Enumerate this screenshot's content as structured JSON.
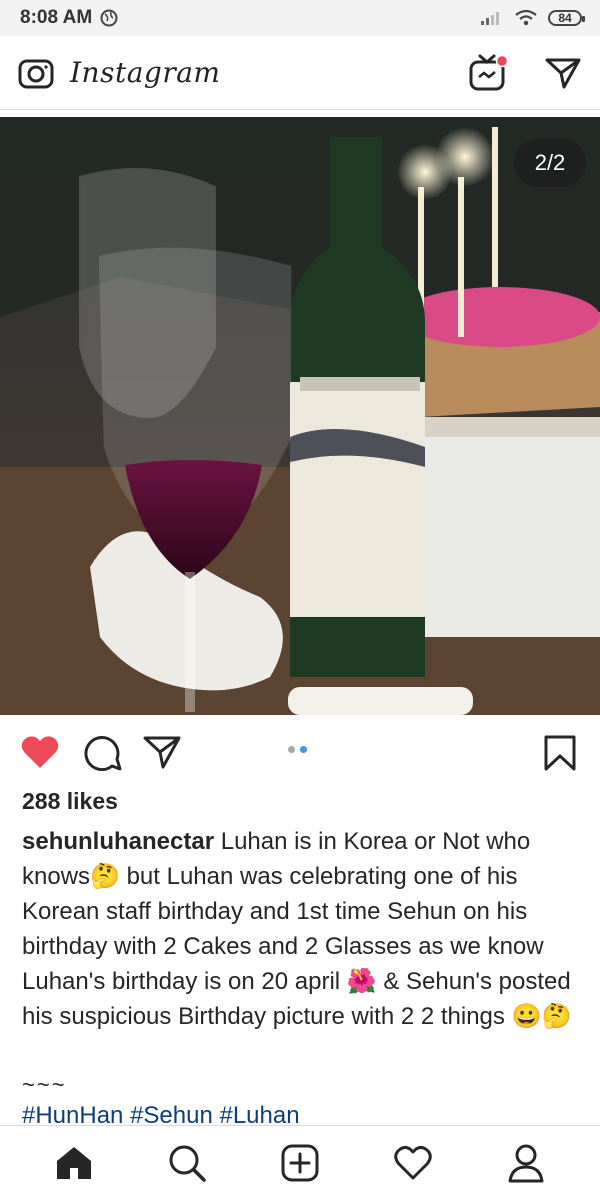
{
  "status_bar": {
    "time": "8:08 AM",
    "battery": "84"
  },
  "header": {
    "app_name": "Instagram"
  },
  "post": {
    "pager": "2/2",
    "likes": "288 likes",
    "username": "sehunluhanectar",
    "caption": " Luhan is in Korea or Not who knows🤔 but Luhan was celebrating one of his Korean staff birthday and 1st time Sehun on his birthday with 2 Cakes and 2 Glasses as we know Luhan's birthday is on 20 april 🌺 & Sehun's posted his suspicious Birthday picture with 2 2 things 😀🤔",
    "separator": "~~~",
    "hashtags": "#HunHan #Sehun #Luhan",
    "carousel": {
      "count": 2,
      "active": 2
    }
  },
  "colors": {
    "like": "#ed4956",
    "hashtag": "#0f3d7a",
    "dot_active": "#3897f0",
    "dot_inactive": "#a8a8a8",
    "notification": "#ed4956"
  },
  "icons": [
    "camera-icon",
    "igtv-icon",
    "direct-icon",
    "heart-icon",
    "comment-icon",
    "share-icon",
    "bookmark-icon",
    "home-icon",
    "search-icon",
    "add-icon",
    "activity-icon",
    "profile-icon"
  ]
}
